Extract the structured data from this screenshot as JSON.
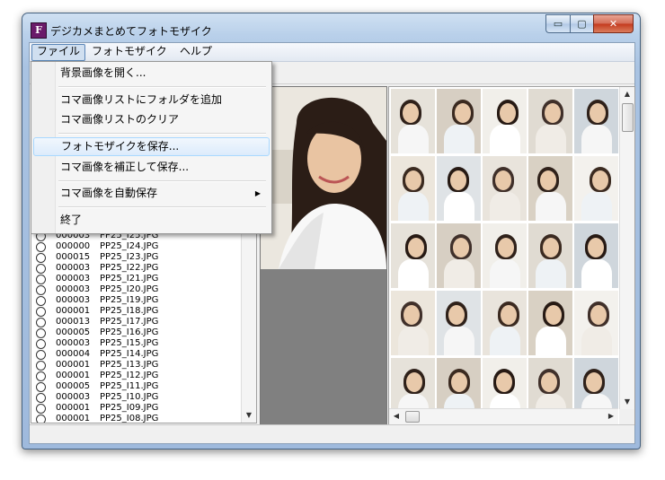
{
  "window": {
    "title": "デジカメまとめてフォトモザイク",
    "app_icon_glyph": "F",
    "minimize_glyph": "▭",
    "maximize_glyph": "▢",
    "close_glyph": "✕"
  },
  "menubar": {
    "items": [
      "ファイル",
      "フォトモザイク",
      "ヘルプ"
    ]
  },
  "file_menu": {
    "items": [
      "背景画像を開く...",
      "コマ画像リストにフォルダを追加",
      "コマ画像リストのクリア",
      "フォトモザイクを保存...",
      "コマ画像を補正して保存...",
      "コマ画像を自動保存",
      "終了"
    ],
    "highlighted": "フォトモザイクを保存..."
  },
  "file_list": {
    "rows": [
      {
        "count": "000003",
        "name": "PP25_I25.JPG"
      },
      {
        "count": "000000",
        "name": "PP25_I24.JPG"
      },
      {
        "count": "000015",
        "name": "PP25_I23.JPG"
      },
      {
        "count": "000003",
        "name": "PP25_I22.JPG"
      },
      {
        "count": "000003",
        "name": "PP25_I21.JPG"
      },
      {
        "count": "000003",
        "name": "PP25_I20.JPG"
      },
      {
        "count": "000003",
        "name": "PP25_I19.JPG"
      },
      {
        "count": "000001",
        "name": "PP25_I18.JPG"
      },
      {
        "count": "000013",
        "name": "PP25_I17.JPG"
      },
      {
        "count": "000005",
        "name": "PP25_I16.JPG"
      },
      {
        "count": "000003",
        "name": "PP25_I15.JPG"
      },
      {
        "count": "000004",
        "name": "PP25_I14.JPG"
      },
      {
        "count": "000001",
        "name": "PP25_I13.JPG"
      },
      {
        "count": "000001",
        "name": "PP25_I12.JPG"
      },
      {
        "count": "000005",
        "name": "PP25_I11.JPG"
      },
      {
        "count": "000003",
        "name": "PP25_I10.JPG"
      },
      {
        "count": "000001",
        "name": "PP25_I09.JPG"
      },
      {
        "count": "000001",
        "name": "PP25_I08.JPG"
      }
    ]
  },
  "scroll": {
    "up_glyph": "▲",
    "down_glyph": "▼",
    "left_glyph": "◀",
    "right_glyph": "▶"
  },
  "colors": {
    "highlight_border": "#a8d8ff",
    "preview_gray": "#808080"
  }
}
